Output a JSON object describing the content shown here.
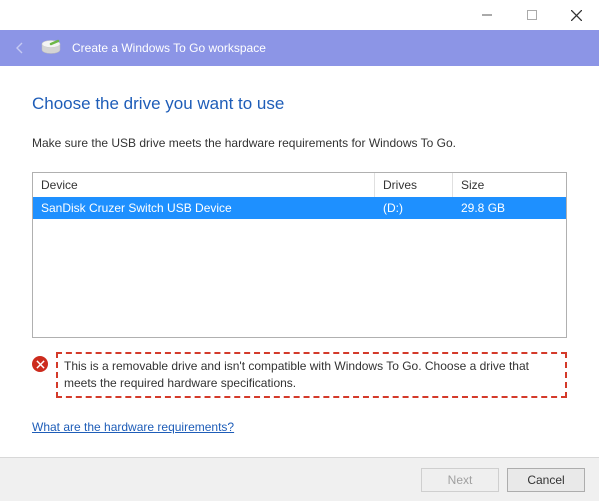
{
  "window": {
    "minimize_label": "Minimize",
    "maximize_label": "Maximize",
    "close_label": "Close"
  },
  "header": {
    "title": "Create a Windows To Go workspace"
  },
  "content": {
    "heading": "Choose the drive you want to use",
    "subheading": "Make sure the USB drive meets the hardware requirements for Windows To Go."
  },
  "table": {
    "columns": {
      "device": "Device",
      "drives": "Drives",
      "size": "Size"
    },
    "rows": [
      {
        "device": "SanDisk Cruzer Switch USB Device",
        "drives": "(D:)",
        "size": "29.8 GB",
        "selected": true
      }
    ]
  },
  "error": {
    "text": "This is a removable drive and isn't compatible with Windows To Go. Choose a drive that meets the required hardware specifications."
  },
  "link": {
    "hardware_requirements": "What are the hardware requirements?"
  },
  "footer": {
    "next": "Next",
    "cancel": "Cancel"
  }
}
